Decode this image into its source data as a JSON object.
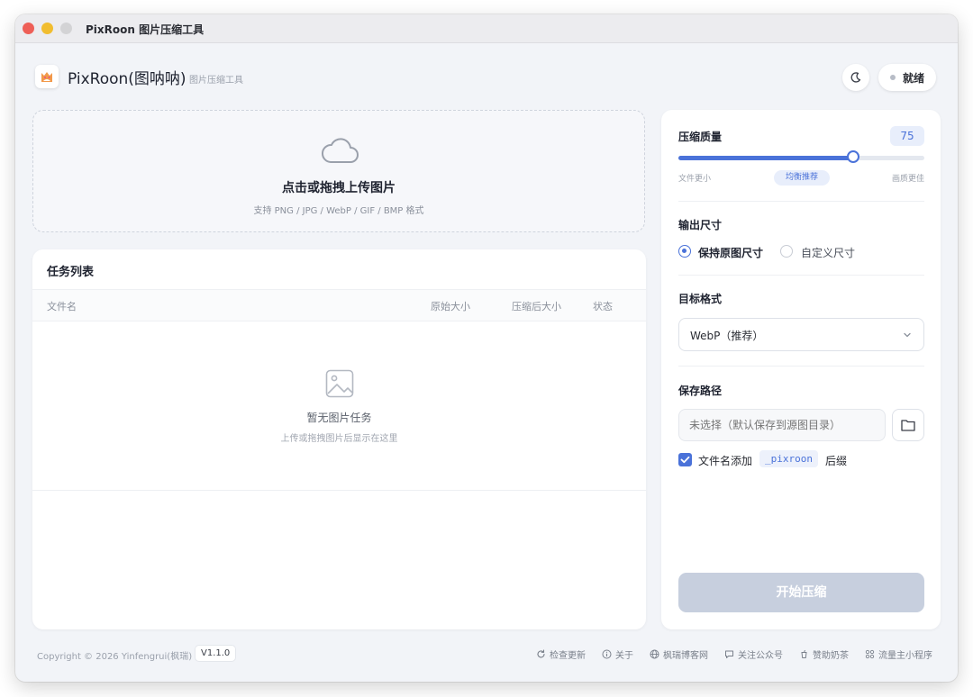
{
  "window": {
    "title": "PixRoon 图片压缩工具"
  },
  "header": {
    "app_name": "PixRoon(图呐呐)",
    "app_subtitle": "图片压缩工具",
    "status": "就绪"
  },
  "dropzone": {
    "title": "点击或拖拽上传图片",
    "formats": "支持 PNG / JPG / WebP / GIF / BMP 格式"
  },
  "task_list": {
    "title": "任务列表",
    "columns": [
      "文件名",
      "原始大小",
      "压缩后大小",
      "状态"
    ],
    "empty_title": "暂无图片任务",
    "empty_hint": "上传或拖拽图片后显示在这里"
  },
  "settings": {
    "quality": {
      "title": "压缩质量",
      "value": 75,
      "display": "75",
      "fraction": 0.71,
      "left_label": "文件更小",
      "middle_label": "均衡推荐",
      "right_label": "画质更佳"
    },
    "size": {
      "title": "输出尺寸",
      "options": [
        "保持原图尺寸",
        "自定义尺寸"
      ],
      "selected": "保持原图尺寸"
    },
    "format": {
      "title": "目标格式",
      "value": "WebP（推荐）"
    },
    "save_path": {
      "title": "保存路径",
      "placeholder": "未选择（默认保存到源图目录）",
      "suffix_before": "文件名添加",
      "suffix": "_pixroon",
      "suffix_after": "后缀"
    },
    "start_label": "开始压缩"
  },
  "footer": {
    "copyright": "Copyright © 2026 Yinfengrui(枫瑞)",
    "version": "V1.1.0",
    "links": [
      {
        "label": "检查更新",
        "icon": "refresh-icon"
      },
      {
        "label": "关于",
        "icon": "info-icon"
      },
      {
        "label": "枫瑞博客网",
        "icon": "globe-icon"
      },
      {
        "label": "关注公众号",
        "icon": "chat-icon"
      },
      {
        "label": "赞助奶茶",
        "icon": "cup-icon"
      },
      {
        "label": "流量主小程序",
        "icon": "grid-icon"
      }
    ]
  },
  "colors": {
    "accent": "#4a72d9",
    "disabled_button": "#c7cfde",
    "window_bg": "#f2f4f8"
  }
}
